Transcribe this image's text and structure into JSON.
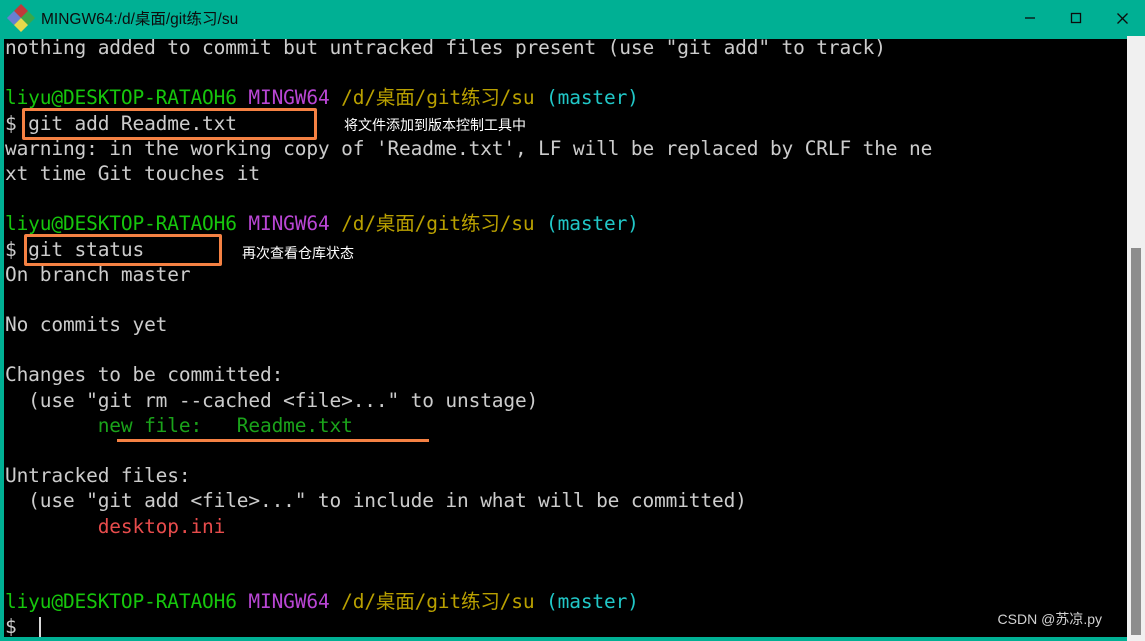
{
  "window": {
    "title": "MINGW64:/d/桌面/git练习/su",
    "app_icon": "git-bash-logo-icon",
    "controls": {
      "minimize": "minimize-icon",
      "maximize": "maximize-icon",
      "close": "close-icon"
    },
    "titlebar_color": "#00b094",
    "terminal_bg": "#000000"
  },
  "prompt": {
    "user_host": "liyu@DESKTOP-RATAOH6",
    "shell": "MINGW64",
    "path": "/d/桌面/git练习/su",
    "branch": "(master)",
    "sigil": "$",
    "colors": {
      "user_host": "#16c60c",
      "shell": "#b946d4",
      "path": "#b9a000",
      "branch": "#21c7c7"
    }
  },
  "terminal": {
    "lines": [
      {
        "id": "l0",
        "segments": [
          {
            "text": "nothing added to commit but untracked files present (use \"git add\" to track)",
            "color": "gray"
          }
        ]
      },
      {
        "id": "l1",
        "segments": [
          {
            "text": "",
            "color": "gray"
          }
        ]
      },
      {
        "id": "l2",
        "segments": [
          {
            "text": "liyu@DESKTOP-RATAOH6",
            "color": "green"
          },
          {
            "text": " ",
            "color": "gray"
          },
          {
            "text": "MINGW64",
            "color": "purple"
          },
          {
            "text": " ",
            "color": "gray"
          },
          {
            "text": "/d/桌面/git练习/su",
            "color": "yellow"
          },
          {
            "text": " ",
            "color": "gray"
          },
          {
            "text": "(master)",
            "color": "cyan"
          }
        ]
      },
      {
        "id": "l3",
        "segments": [
          {
            "text": "$ git add Readme.txt",
            "color": "gray"
          }
        ]
      },
      {
        "id": "l4",
        "segments": [
          {
            "text": "warning: in the working copy of 'Readme.txt', LF will be replaced by CRLF the ne",
            "color": "gray"
          }
        ]
      },
      {
        "id": "l5",
        "segments": [
          {
            "text": "xt time Git touches it",
            "color": "gray"
          }
        ]
      },
      {
        "id": "l6",
        "segments": [
          {
            "text": "",
            "color": "gray"
          }
        ]
      },
      {
        "id": "l7",
        "segments": [
          {
            "text": "liyu@DESKTOP-RATAOH6",
            "color": "green"
          },
          {
            "text": " ",
            "color": "gray"
          },
          {
            "text": "MINGW64",
            "color": "purple"
          },
          {
            "text": " ",
            "color": "gray"
          },
          {
            "text": "/d/桌面/git练习/su",
            "color": "yellow"
          },
          {
            "text": " ",
            "color": "gray"
          },
          {
            "text": "(master)",
            "color": "cyan"
          }
        ]
      },
      {
        "id": "l8",
        "segments": [
          {
            "text": "$ git status",
            "color": "gray"
          }
        ]
      },
      {
        "id": "l9",
        "segments": [
          {
            "text": "On branch master",
            "color": "gray"
          }
        ]
      },
      {
        "id": "l10",
        "segments": [
          {
            "text": "",
            "color": "gray"
          }
        ]
      },
      {
        "id": "l11",
        "segments": [
          {
            "text": "No commits yet",
            "color": "gray"
          }
        ]
      },
      {
        "id": "l12",
        "segments": [
          {
            "text": "",
            "color": "gray"
          }
        ]
      },
      {
        "id": "l13",
        "segments": [
          {
            "text": "Changes to be committed:",
            "color": "gray"
          }
        ]
      },
      {
        "id": "l14",
        "segments": [
          {
            "text": "  (use \"git rm --cached <file>...\" to unstage)",
            "color": "gray"
          }
        ]
      },
      {
        "id": "l15",
        "segments": [
          {
            "text": "        new file:   Readme.txt",
            "color": "gitgreen"
          }
        ]
      },
      {
        "id": "l16",
        "segments": [
          {
            "text": "",
            "color": "gray"
          }
        ]
      },
      {
        "id": "l17",
        "segments": [
          {
            "text": "Untracked files:",
            "color": "gray"
          }
        ]
      },
      {
        "id": "l18",
        "segments": [
          {
            "text": "  (use \"git add <file>...\" to include in what will be committed)",
            "color": "gray"
          }
        ]
      },
      {
        "id": "l19",
        "segments": [
          {
            "text": "        desktop.ini",
            "color": "red"
          }
        ]
      },
      {
        "id": "l20",
        "segments": [
          {
            "text": "",
            "color": "gray"
          }
        ]
      },
      {
        "id": "l21",
        "segments": [
          {
            "text": "",
            "color": "gray"
          }
        ]
      },
      {
        "id": "l22",
        "segments": [
          {
            "text": "liyu@DESKTOP-RATAOH6",
            "color": "green"
          },
          {
            "text": " ",
            "color": "gray"
          },
          {
            "text": "MINGW64",
            "color": "purple"
          },
          {
            "text": " ",
            "color": "gray"
          },
          {
            "text": "/d/桌面/git练习/su",
            "color": "yellow"
          },
          {
            "text": " ",
            "color": "gray"
          },
          {
            "text": "(master)",
            "color": "cyan"
          }
        ]
      },
      {
        "id": "l23",
        "segments": [
          {
            "text": "$ ",
            "color": "gray"
          }
        ]
      }
    ]
  },
  "annotations": {
    "highlight_color": "#f58143",
    "box_git_add": {
      "label": "git add Readme.txt"
    },
    "box_git_status": {
      "label": "git status"
    },
    "note_git_add": "将文件添加到版本控制工具中",
    "note_git_status": "再次查看仓库状态",
    "underline_new_file": "new file:   Readme.txt"
  },
  "watermark": {
    "text": "CSDN @苏凉.py"
  },
  "scrollbar": {
    "thumb_top_pct": 35,
    "thumb_height_pct": 64
  }
}
